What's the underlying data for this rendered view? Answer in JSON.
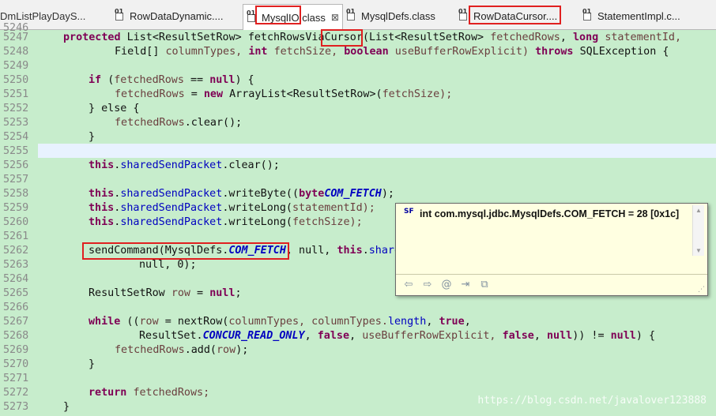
{
  "tabs": [
    {
      "label": "DmListPlayDayS..."
    },
    {
      "label": "RowDataDynamic...."
    },
    {
      "label": "MysqlIO.class",
      "close": "⊠"
    },
    {
      "label": "MysqlDefs.class"
    },
    {
      "label": "RowDataCursor...."
    },
    {
      "label": "StatementImpl.c..."
    }
  ],
  "editor": {
    "line_numbers": [
      "5246",
      "5247",
      "5248",
      "5249",
      "5250",
      "5251",
      "5252",
      "5253",
      "5254",
      "5255",
      "5256",
      "5257",
      "5258",
      "5259",
      "5260",
      "5261",
      "5262",
      "5263",
      "5264",
      "5265",
      "5266",
      "5267",
      "5268",
      "5269",
      "5270",
      "5271",
      "5272",
      "5273"
    ],
    "tokens": {
      "protected": "protected",
      "list_rs": "List<ResultSetRow>",
      "fetch_name": "fetchRowsVia",
      "cursor": "Cursor",
      "list_rs_paren": "(List<ResultSetRow>",
      "fetchedRows": "fetchedRows",
      "long": "long",
      "statementId": "statementId,",
      "field_arr": "Field[]",
      "columnTypes": "columnTypes,",
      "int": "int",
      "fetchSize": "fetchSize,",
      "boolean": "boolean",
      "useBuffer": "useBufferRowExplicit)",
      "throws": "throws",
      "sqlex": "SQLException {",
      "if": "if",
      "if_open": "(",
      "eq": " == ",
      "null": "null",
      "close_brace_open": ") {",
      "assign": " = ",
      "new": "new",
      "arraylist": "ArrayList<ResultSetRow>(",
      "fetchSize_close": "fetchSize);",
      "else_open": "} else {",
      "clear_call": ".clear();",
      "close_brace": "}",
      "this": "this",
      "sharedSendPacket": "sharedSendPacket",
      "writeByte_open": ".writeByte((",
      "byte": "byte",
      ") MysqlDefs.": ") MysqlDefs.",
      "COM_FETCH": "COM_FETCH",
      "close_paren_semi": ");",
      "writeLong_open": ".writeLong(",
      "statementId_close": "statementId);",
      "fetchSize_close2": "fetchSize);",
      "sendCommand": "sendCommand(MysqlDefs.",
      "comma_null": ", null,",
      "shar": "share",
      "null_zero": "null, 0);",
      "rsr": "ResultSetRow",
      "row": "row",
      "assign_null": " = ",
      "semi": ";",
      "while": "while",
      "while_open": " ((",
      "nextrow": " = nextRow(",
      "columnTypes2": "columnTypes,",
      "columnTypes3": " columnTypes.",
      "length": "length",
      ", ": ", ",
      "true": "true",
      "rs_dot": "ResultSet.",
      "CONCUR": "CONCUR_READ_ONLY",
      "false": "false",
      "useBuffer2": "useBufferRowExplicit,",
      "neq": ")) != ",
      "brace_open": ") {",
      "add_row": ".add(",
      "row2": "row",
      "close_semi": ");",
      "return": "return",
      "fetchedRows_semi": "fetchedRows;"
    }
  },
  "popup": {
    "icon_text": "SF",
    "message": "int com.mysql.jdbc.MysqlDefs.COM_FETCH = 28 [0x1c]",
    "toolbar": [
      "back-icon",
      "forward-icon",
      "at-icon",
      "open-declaration-icon",
      "open-external-icon"
    ]
  },
  "watermark": "https://blog.csdn.net/javalover123888"
}
